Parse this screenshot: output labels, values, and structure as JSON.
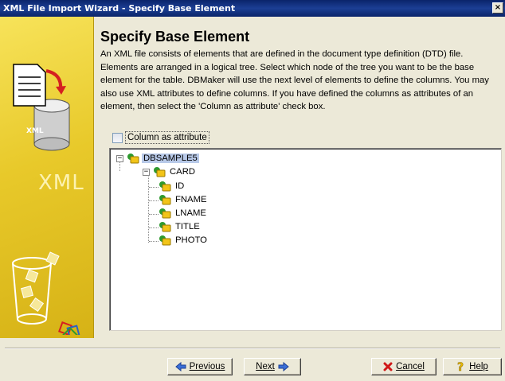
{
  "window": {
    "title": "XML File Import Wizard - Specify Base Element",
    "close_glyph": "×"
  },
  "banner": {
    "big_text": "XML",
    "small_text": "XML"
  },
  "page": {
    "heading": "Specify Base Element",
    "description": "An XML file consists of elements that are defined in the document type definition (DTD) file. Elements are arranged in a logical tree. Select which node of the tree you want to be the base element for the table. DBMaker will use the next level of elements to define the columns. You may also use XML attributes to define columns. If you have defined the columns as attributes of an element, then select the 'Column as attribute' check box."
  },
  "option": {
    "column_as_attribute_label": "Column as attribute",
    "column_as_attribute_checked": false
  },
  "tree": {
    "root": {
      "label": "DBSAMPLE5",
      "selected": true,
      "child": {
        "label": "CARD",
        "children": [
          "ID",
          "FNAME",
          "LNAME",
          "TITLE",
          "PHOTO"
        ]
      }
    },
    "collapse_glyph": "−"
  },
  "buttons": {
    "previous": {
      "label": "Previous",
      "icon": "arrow-left-icon"
    },
    "next": {
      "label": "Next",
      "icon": "arrow-right-icon"
    },
    "cancel": {
      "label": "Cancel",
      "icon": "red-x-icon"
    },
    "help": {
      "label": "Help",
      "icon": "question-mark-icon"
    }
  },
  "colors": {
    "titlebar": "#0a246a",
    "banner": "#e8c92a",
    "selection": "#b8c9e8",
    "folder_green": "#2e9a2e",
    "folder_yellow": "#f2c418"
  }
}
